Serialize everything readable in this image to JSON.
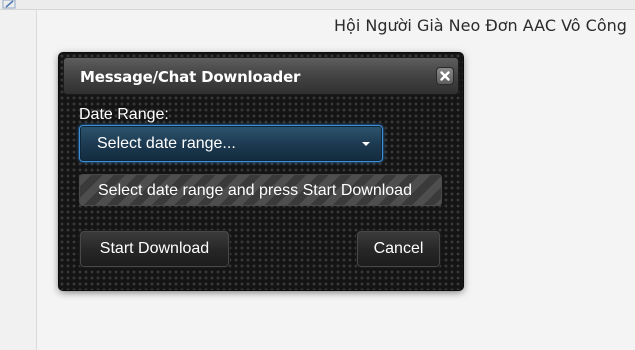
{
  "background": {
    "group_title": "Hội Người Già Neo Đơn AAC Vô Công"
  },
  "dialog": {
    "title": "Message/Chat Downloader",
    "close_icon": "close-icon",
    "date_range_label": "Date Range:",
    "date_range_select": {
      "selected": "Select date range...",
      "icon": "chevron-down-icon"
    },
    "status_text": "Select date range and press Start Download",
    "start_button_label": "Start Download",
    "cancel_button_label": "Cancel"
  },
  "colors": {
    "modal_background": "#141414",
    "select_border_accent": "#3f8fd8",
    "select_background": "#1d3b52",
    "text": "#ffffff"
  }
}
